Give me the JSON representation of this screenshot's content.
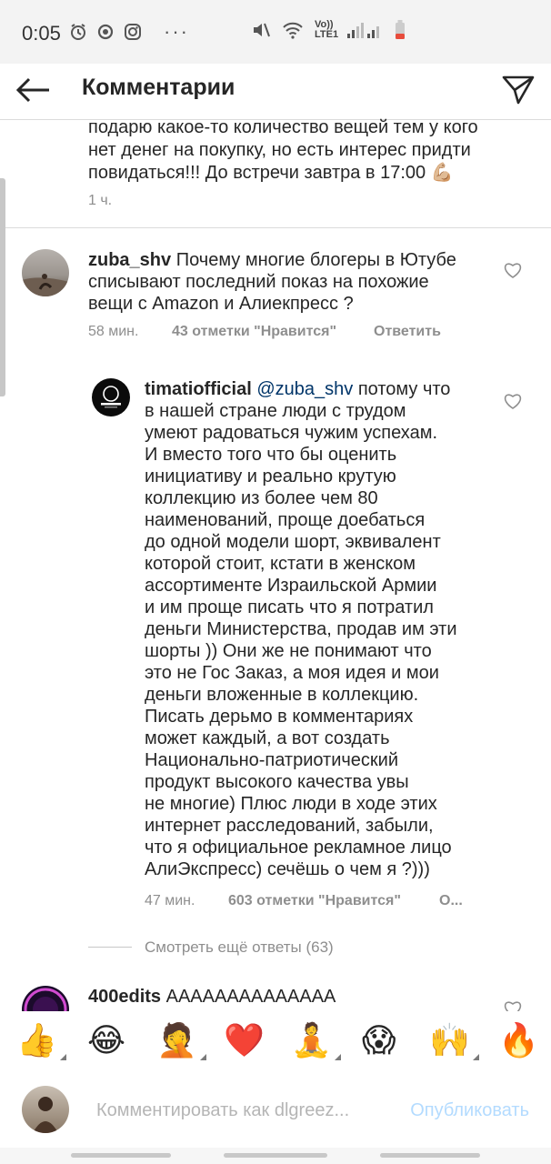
{
  "status_bar": {
    "time": "0:05",
    "network": "Vo)) LTE1",
    "icons": [
      "alarm-icon",
      "sync-icon",
      "instagram-icon",
      "more-dots-icon",
      "mute-icon",
      "wifi-icon",
      "signal-icon",
      "battery-icon"
    ],
    "dots": "···"
  },
  "header": {
    "title": "Комментарии",
    "icons": [
      "back-arrow-icon",
      "send-icon"
    ]
  },
  "caption": {
    "lines": [
      "подарю какое-то количество вещей тем у кого",
      "нет денег на покупку, но есть интерес придти",
      "повидаться!!! До встречи завтра в 17:00 💪🏼"
    ],
    "time": "1 ч."
  },
  "comment1": {
    "username": "zuba_shv",
    "text_line1": " Почему многие блогеры в Ютубе",
    "text_line2": "списывают последний показ на похожие",
    "text_line3": "вещи с Amazon и Алиекпресс ?",
    "time": "58 мин.",
    "likes": "43 отметки \"Нравится\"",
    "reply": "Ответить"
  },
  "reply1": {
    "username": "timatiofficial",
    "mention": "@zuba_shv",
    "first_line_rest": " потому что",
    "lines": [
      "в нашей стране люди с трудом",
      "умеют радоваться чужим успехам.",
      "И вместо того что бы оценить",
      "инициативу и реально крутую",
      "коллекцию из более чем 80",
      "наименований, проще доебаться",
      "до одной модели шорт, эквивалент",
      "которой стоит, кстати в женском",
      "ассортименте Израильской Армии",
      "и им проще писать что я потратил",
      "деньги Министерства, продав им эти",
      "шорты )) Они же не понимают что",
      "это не Гос Заказ, а моя идея и мои",
      "деньги вложенные в коллекцию.",
      "Писать дерьмо в комментариях",
      "может каждый, а вот создать",
      "Национально-патриотический",
      "продукт высокого качества увы",
      "не многие) Плюс люди в ходе этих",
      "интернет расследований, забыли,",
      "что я официальное рекламное лицо",
      "АлиЭкспресс) сечёшь о чем я ?)))"
    ],
    "time": "47 мин.",
    "likes": "603 отметки \"Нравится\"",
    "reply": "О..."
  },
  "view_more": "Смотреть ещё ответы (63)",
  "comment2": {
    "username": "400edits",
    "text": " АААААААААААААА"
  },
  "emoji_bar": {
    "items": [
      "👍",
      "😂",
      "🤦",
      "❤️",
      "🧘",
      "😱",
      "🙌",
      "🔥"
    ]
  },
  "input": {
    "placeholder": "Комментировать как dlgreez...",
    "publish": "Опубликовать"
  },
  "colors": {
    "link_blue": "#003569",
    "publish_disabled": "#b3dbff",
    "meta_gray": "#8e8e8e"
  }
}
